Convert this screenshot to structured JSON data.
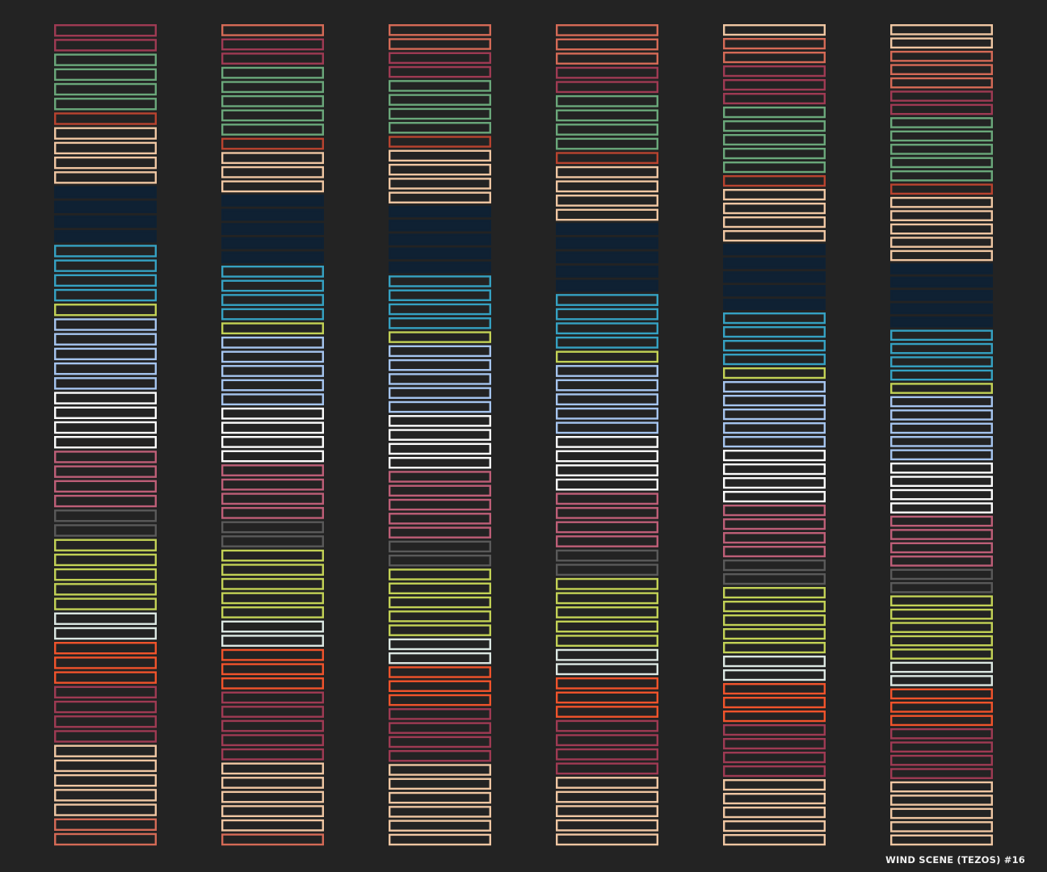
{
  "caption": "WIND SCENE (TEZOS) #16",
  "colors": {
    "background": "#232323",
    "palette": {
      "M": "#9e3a53",
      "S": "#d46a56",
      "G": "#6aa77a",
      "R": "#b8432f",
      "P": "#efc6a2",
      "N": "#0f2133",
      "B": "#35a1c2",
      "Y": "#c2d155",
      "L": "#a5c4ee",
      "W": "#fdfdfd",
      "K": "#bd5e77",
      "D": "#595959",
      "C": "#dbe7e2",
      "O": "#f0532b"
    }
  },
  "columns": [
    "MMGGGGRPPPPNNNNBBBBYLLLLLWWWWKKKKDDYYYYYCCOOOMMMMPPPPPSS",
    "SMMGGGGGRPPPNNNNNBBBBYLLLLLWWWWKKKKDDYYYYYCCOOOMMMMMPPPPPS",
    "SSMMGGGGRPPPPNNNNNBBBBYLLLLLWWWWKKKKKDDYYYYYCCOOOMMMMPPPPPP",
    "SSSMMGGGGRPPPPNNNNNBBBBYLLLLLWWWWKKKKDDYYYYYCCOOOMMMMPPPPP",
    "PSSMMMGGGGGRPPPPNNNNNBBBBYLLLLLWWWWKKKKDDYYYYYCCOOOMMMMPPPPP",
    "PPSSSMMGGGGGRPPPPPNNNNNBBBBYLLLLLWWWWKKKKDDYYYYYCCOOOMMMMPPPPP"
  ]
}
